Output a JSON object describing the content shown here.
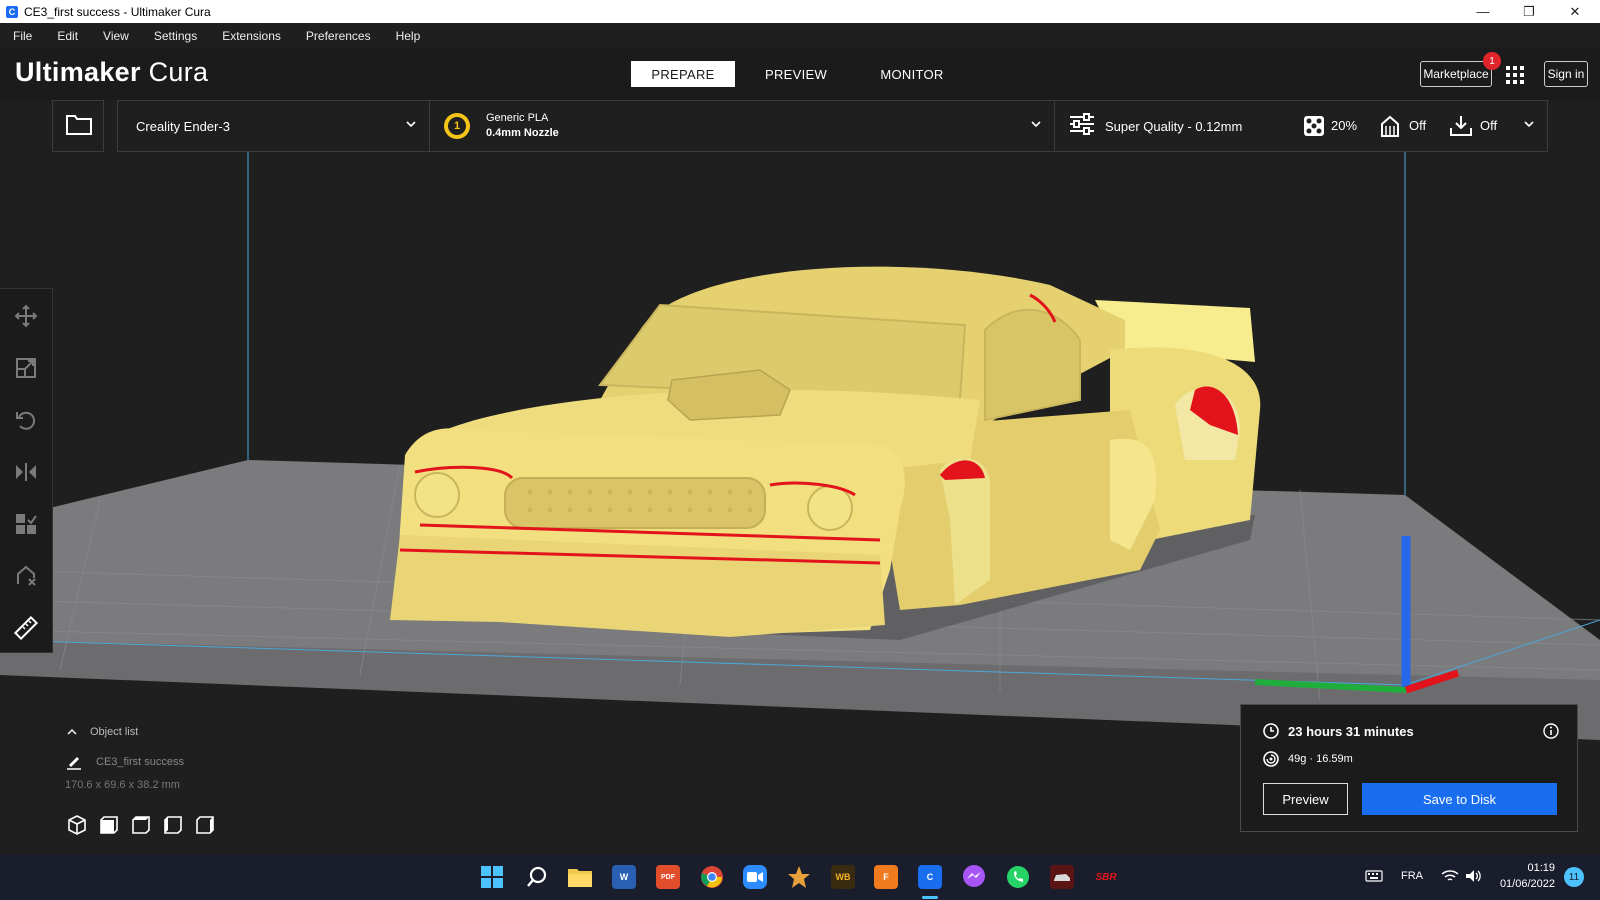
{
  "window": {
    "title": "CE3_first success - Ultimaker Cura",
    "minimize_glyph": "—",
    "restore_glyph": "❐",
    "close_glyph": "✕"
  },
  "menu": [
    "File",
    "Edit",
    "View",
    "Settings",
    "Extensions",
    "Preferences",
    "Help"
  ],
  "header": {
    "logo_bold": "Ultimaker",
    "logo_light": "Cura",
    "stages": [
      {
        "label": "PREPARE",
        "active": true
      },
      {
        "label": "PREVIEW",
        "active": false
      },
      {
        "label": "MONITOR",
        "active": false
      }
    ],
    "marketplace_label": "Marketplace",
    "marketplace_badge": "1",
    "signin_label": "Sign in"
  },
  "config": {
    "printer": "Creality Ender-3",
    "extruder_number": "1",
    "material": "Generic PLA",
    "nozzle": "0.4mm Nozzle",
    "profile": "Super Quality - 0.12mm",
    "infill": "20%",
    "support": "Off",
    "adhesion": "Off"
  },
  "objects": {
    "title": "Object list",
    "item": "CE3_first success",
    "dimensions": "170.6 x 69.6 x 38.2 mm"
  },
  "action": {
    "time": "23 hours 31 minutes",
    "material_usage": "49g · 16.59m",
    "preview_label": "Preview",
    "save_label": "Save to Disk"
  },
  "taskbar": {
    "apps": [
      {
        "name": "start",
        "text": ""
      },
      {
        "name": "search",
        "text": ""
      },
      {
        "name": "file-explorer",
        "text": ""
      },
      {
        "name": "word",
        "text": "W"
      },
      {
        "name": "pdf-app",
        "text": "PDF"
      },
      {
        "name": "chrome",
        "text": ""
      },
      {
        "name": "zoom",
        "text": ""
      },
      {
        "name": "app-starburst",
        "text": ""
      },
      {
        "name": "app-wb",
        "text": "WB"
      },
      {
        "name": "app-f360",
        "text": "F"
      },
      {
        "name": "cura",
        "text": "C"
      },
      {
        "name": "messenger",
        "text": ""
      },
      {
        "name": "whatsapp",
        "text": ""
      },
      {
        "name": "app-car",
        "text": ""
      },
      {
        "name": "app-sbr",
        "text": "SBR"
      }
    ],
    "language": "FRA",
    "time": "01:19",
    "date": "01/06/2022",
    "notifications": "11"
  },
  "colors": {
    "accent": "#196ef0",
    "model": "#f4e38a",
    "overhang": "#e3131b",
    "plate": "#7f7f82"
  }
}
